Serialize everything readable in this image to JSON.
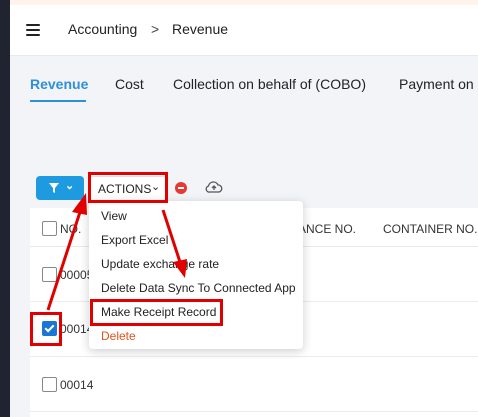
{
  "breadcrumb": {
    "root": "Accounting",
    "separator": ">",
    "current": "Revenue"
  },
  "tabs": [
    "Revenue",
    "Cost",
    "Collection on behalf of (COBO)",
    "Payment on"
  ],
  "toolbar": {
    "filter_chevron": "⌄",
    "actions_label": "ACTIONS",
    "actions_chevron": "⌄"
  },
  "table": {
    "columns": [
      "NO.",
      "ANCE NO.",
      "CONTAINER NO."
    ],
    "rows": [
      {
        "no": "00005",
        "checked": false
      },
      {
        "no": "00014",
        "checked": true
      },
      {
        "no": "00014",
        "checked": false
      }
    ]
  },
  "actions_menu": [
    "View",
    "Export Excel",
    "Update exchange rate",
    "Delete Data Sync To Connected App",
    "Make Receipt Record",
    "Delete"
  ],
  "colors": {
    "accent": "#2f8fd8",
    "highlight": "#e00000",
    "danger": "#e0541e"
  },
  "icons": [
    "menu-icon",
    "filter-icon",
    "chevron-down-icon",
    "stop-icon",
    "cloud-upload-icon"
  ]
}
